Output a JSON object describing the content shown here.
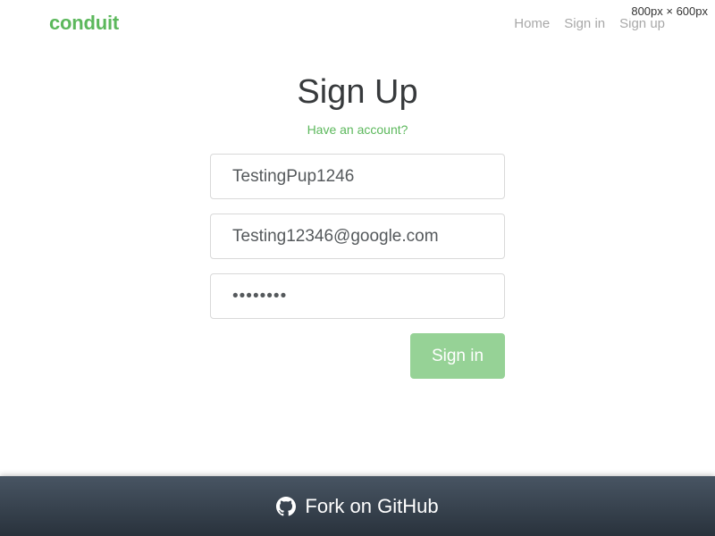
{
  "navbar": {
    "brand": "conduit",
    "links": [
      {
        "label": "Home"
      },
      {
        "label": "Sign in"
      },
      {
        "label": "Sign up"
      }
    ]
  },
  "overlay": {
    "dimensions": "800px × 600px"
  },
  "auth": {
    "title": "Sign Up",
    "have_account": "Have an account?",
    "fields": {
      "username": {
        "value": "TestingPup1246"
      },
      "email": {
        "value": "Testing12346@google.com"
      },
      "password": {
        "value": "••••••••"
      }
    },
    "submit_label": "Sign in"
  },
  "footer": {
    "icon": "github-icon",
    "text": "Fork on GitHub"
  },
  "colors": {
    "brand": "#5cb85c",
    "button": "#96d296",
    "footer_top": "#485563",
    "footer_bottom": "#29323c"
  }
}
